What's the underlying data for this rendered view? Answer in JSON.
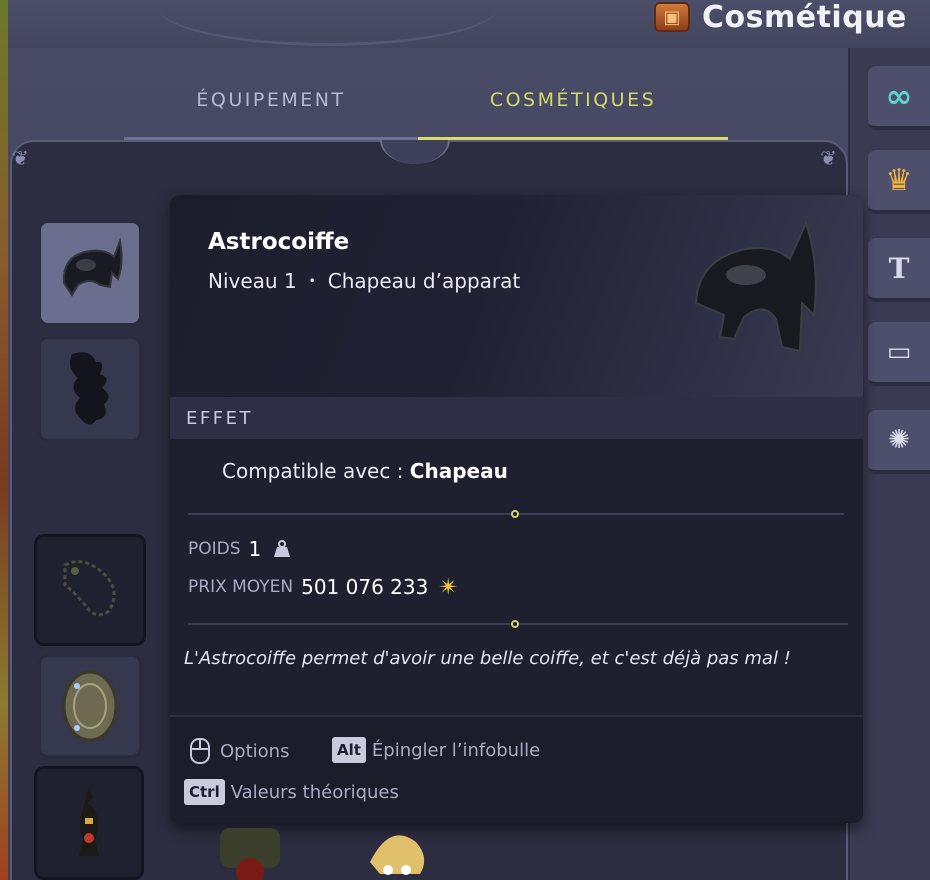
{
  "header": {
    "title": "Cosmétique",
    "title_icon": "cosmetic-chest-icon"
  },
  "tabs": [
    {
      "label": "ÉQUIPEMENT",
      "active": false
    },
    {
      "label": "COSMÉTIQUES",
      "active": true
    }
  ],
  "slots": [
    {
      "name": "hat-slot",
      "icon": "helmet-icon",
      "active": true
    },
    {
      "name": "cape-slot",
      "icon": "cape-icon",
      "active": false
    },
    {
      "name": "pet-slot",
      "icon": "pet-icon",
      "active": false
    },
    {
      "name": "shield-slot",
      "icon": "shield-icon",
      "active": false
    },
    {
      "name": "costume-slot",
      "icon": "costume-icon",
      "active": false
    }
  ],
  "side_buttons": [
    {
      "name": "infinity-button",
      "icon": "infinity-icon"
    },
    {
      "name": "crown-button",
      "icon": "crown-icon"
    },
    {
      "name": "text-button",
      "icon": "text-icon"
    },
    {
      "name": "banner-button",
      "icon": "banner-icon"
    },
    {
      "name": "idea-button",
      "icon": "lightbulb-icon"
    }
  ],
  "tooltip": {
    "name": "Astrocoiffe",
    "level": "Niveau 1",
    "separator": "•",
    "type": "Chapeau d’apparat",
    "effect_header": "EFFET",
    "effect_prefix": "Compatible avec :",
    "effect_value": "Chapeau",
    "weight_label": "POIDS",
    "weight_value": "1",
    "price_label": "PRIX MOYEN",
    "price_value": "501 076 233",
    "description": "L'Astrocoiffe permet d'avoir une belle coiffe, et c'est déjà pas mal !",
    "footer": {
      "options_label": "Options",
      "alt_key": "Alt",
      "alt_label": "Épingler l’infobulle",
      "ctrl_key": "Ctrl",
      "ctrl_label": "Valeurs théoriques"
    }
  },
  "colors": {
    "accent_tab": "#d8dc6a",
    "kama_gold": "#f0c23a"
  }
}
